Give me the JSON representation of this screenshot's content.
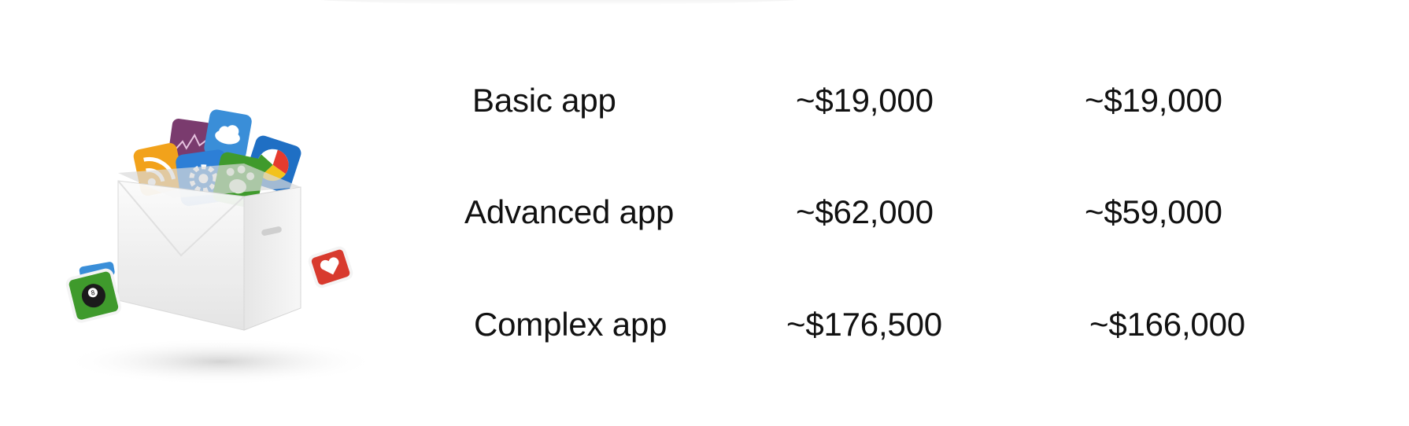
{
  "pricing_table": {
    "rows": [
      {
        "label": "Basic app",
        "value_1": "~$19,000",
        "value_2": "~$19,000"
      },
      {
        "label": "Advanced app",
        "value_1": "~$62,000",
        "value_2": "~$59,000"
      },
      {
        "label": "Complex app",
        "value_1": "~$176,500",
        "value_2": "~$166,000"
      }
    ]
  },
  "illustration": {
    "name": "app-icons-box-illustration",
    "icons": [
      "rss-icon",
      "chart-icon",
      "cloud-icon",
      "gear-icon",
      "paw-icon",
      "pie-chart-icon",
      "eight-ball-icon",
      "heart-icon"
    ],
    "colors": {
      "box": "#f1f1f1",
      "purple": "#7a3b6e",
      "blue": "#3a8ed8",
      "orange": "#f2a21b",
      "green": "#3f9a2c",
      "red": "#d83a2e"
    }
  }
}
